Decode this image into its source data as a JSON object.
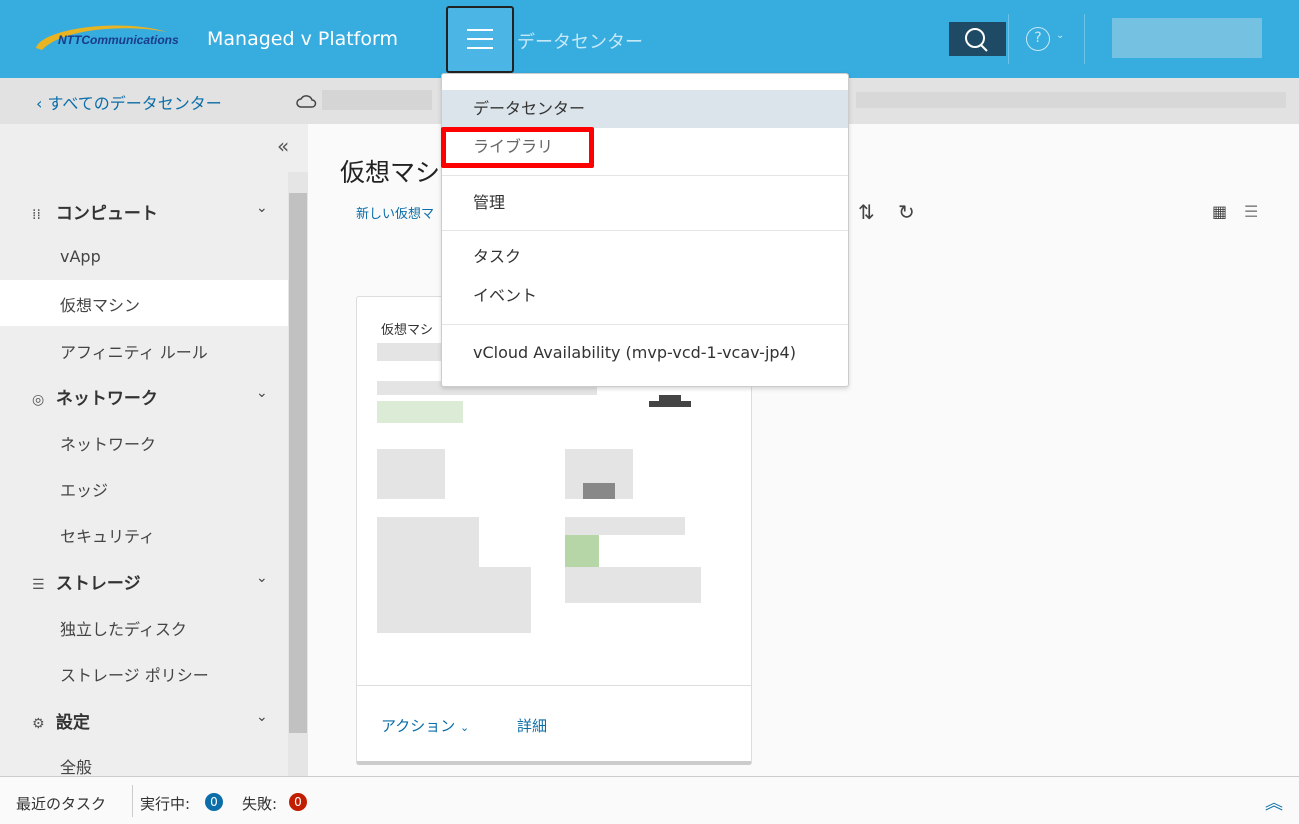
{
  "header": {
    "logo_text": "NTTCommunications",
    "app_title": "Managed v Platform",
    "context": "データセンター"
  },
  "subheader": {
    "back_label": "すべてのデータセンター"
  },
  "sidebar": {
    "sections": [
      {
        "label": "コンピュート",
        "items": [
          "vApp",
          "仮想マシン",
          "アフィニティ ルール"
        ]
      },
      {
        "label": "ネットワーク",
        "items": [
          "ネットワーク",
          "エッジ",
          "セキュリティ"
        ]
      },
      {
        "label": "ストレージ",
        "items": [
          "独立したディスク",
          "ストレージ ポリシー"
        ]
      },
      {
        "label": "設定",
        "items": [
          "全般"
        ]
      }
    ]
  },
  "main": {
    "title": "仮想マシ",
    "new_vm": "新しい仮想マ",
    "card": {
      "title": "仮想マシ",
      "actions": "アクション",
      "details": "詳細"
    }
  },
  "menu": {
    "items": [
      "データセンター",
      "ライブラリ",
      "管理",
      "タスク",
      "イベント",
      "vCloud Availability (mvp-vcd-1-vcav-jp4)"
    ]
  },
  "footer": {
    "recent": "最近のタスク",
    "running": "実行中:",
    "running_count": "0",
    "failed": "失敗:",
    "failed_count": "0"
  },
  "colors": {
    "header": "#36acdf",
    "link": "#0b6ea8",
    "highlight": "#f00"
  }
}
